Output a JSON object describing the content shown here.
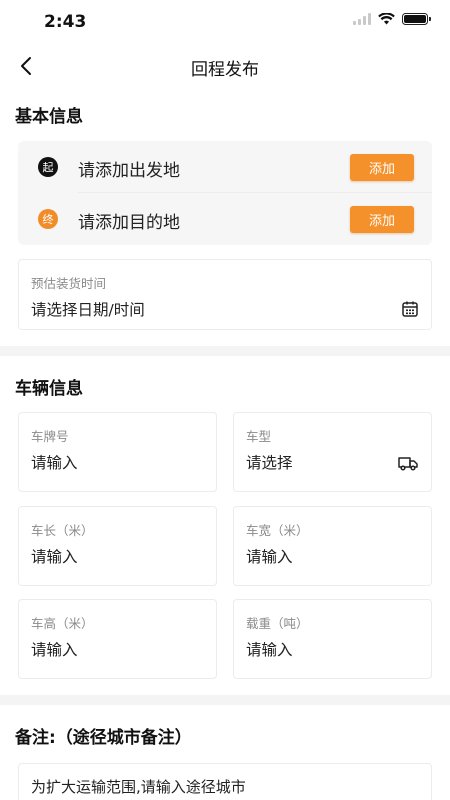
{
  "status_bar": {
    "time": "2:43",
    "icons": [
      "signal-icon",
      "wifi-icon",
      "battery-icon"
    ]
  },
  "nav": {
    "title": "回程发布",
    "back_icon": "chevron-left-icon"
  },
  "basic_info": {
    "title": "基本信息",
    "origin": {
      "badge": "起",
      "placeholder": "请添加出发地",
      "button": "添加"
    },
    "destination": {
      "badge": "终",
      "placeholder": "请添加目的地",
      "button": "添加"
    },
    "loading_time": {
      "label": "预估装货时间",
      "placeholder": "请选择日期/时间",
      "icon": "calendar-icon"
    }
  },
  "vehicle_info": {
    "title": "车辆信息",
    "fields": {
      "plate": {
        "label": "车牌号",
        "placeholder": "请输入"
      },
      "type": {
        "label": "车型",
        "placeholder": "请选择",
        "icon": "truck-icon"
      },
      "length": {
        "label": "车长（米）",
        "placeholder": "请输入"
      },
      "width": {
        "label": "车宽（米）",
        "placeholder": "请输入"
      },
      "height": {
        "label": "车高（米）",
        "placeholder": "请输入"
      },
      "load": {
        "label": "载重（吨）",
        "placeholder": "请输入"
      }
    }
  },
  "remarks": {
    "title": "备注:（途径城市备注）",
    "placeholder": "为扩大运输范围,请输入途径城市"
  },
  "colors": {
    "accent": "#f5912b",
    "destination_badge": "#f28c28",
    "origin_badge": "#111111",
    "card_bg": "#f6f6f6",
    "divider": "#f4f4f4"
  }
}
